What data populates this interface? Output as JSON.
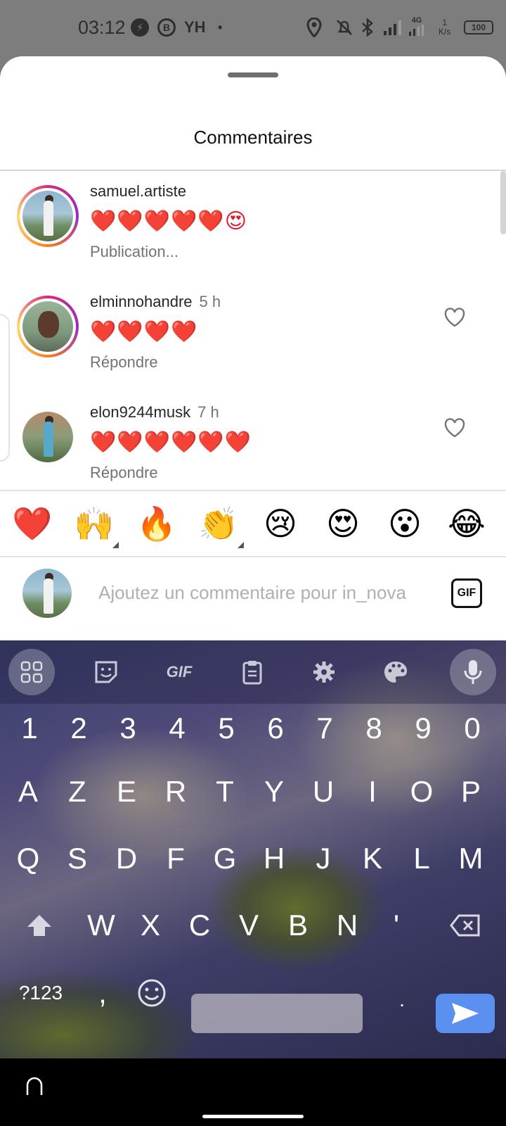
{
  "status_bar": {
    "time": "03:12",
    "network_type": "4G",
    "speed_value": "1",
    "speed_unit": "K/s",
    "battery": "100"
  },
  "sheet": {
    "title": "Commentaires"
  },
  "comments": [
    {
      "username": "samuel.artiste",
      "time": "",
      "text": "❤️❤️❤️❤️❤️😍",
      "action": "Publication..."
    },
    {
      "username": "elminnohandre",
      "time": "5 h",
      "text": "❤️❤️❤️❤️",
      "action": "Répondre"
    },
    {
      "username": "elon9244musk",
      "time": "7 h",
      "text": "❤️❤️❤️❤️❤️❤️",
      "action": "Répondre"
    }
  ],
  "emoji_bar": [
    "❤️",
    "🙌",
    "🔥",
    "👏",
    "😢",
    "😍",
    "😮",
    "😂"
  ],
  "comment_input": {
    "placeholder": "Ajoutez un commentaire pour in_nova",
    "value": "",
    "gif_label": "GIF"
  },
  "keyboard": {
    "toolbar": [
      "apps-grid",
      "sticker",
      "GIF",
      "clipboard",
      "settings",
      "palette",
      "microphone"
    ],
    "gif_label": "GIF",
    "number_row": [
      "1",
      "2",
      "3",
      "4",
      "5",
      "6",
      "7",
      "8",
      "9",
      "0"
    ],
    "row1": [
      "A",
      "Z",
      "E",
      "R",
      "T",
      "Y",
      "U",
      "I",
      "O",
      "P"
    ],
    "row2": [
      "Q",
      "S",
      "D",
      "F",
      "G",
      "H",
      "J",
      "K",
      "L",
      "M"
    ],
    "row3": [
      "W",
      "X",
      "C",
      "V",
      "B",
      "N",
      "'"
    ],
    "symbols_label": "?123",
    "comma": ",",
    "period": "."
  },
  "colors": {
    "heart": "#e0182d",
    "send_key": "#5b8ff0",
    "story_ring": "#d62976"
  }
}
